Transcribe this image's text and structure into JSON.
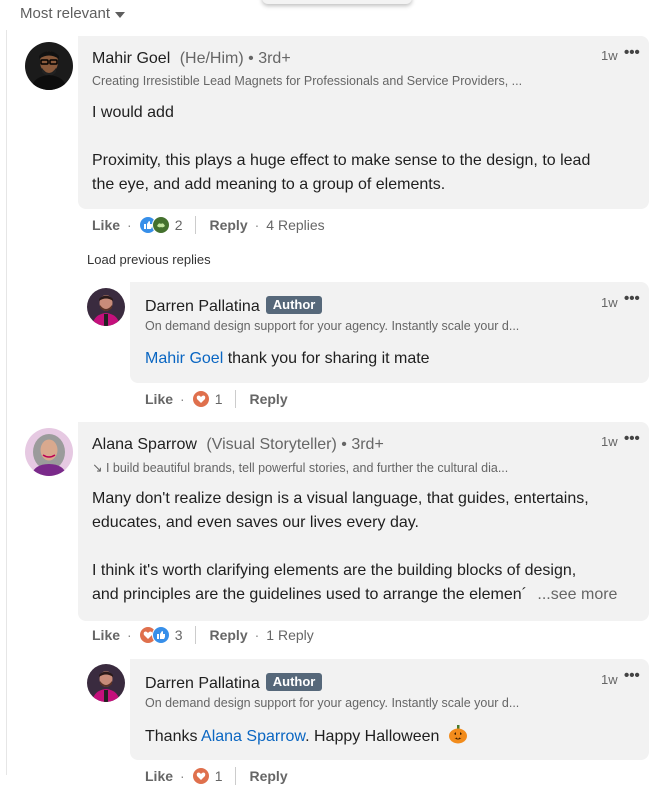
{
  "sort": {
    "label": "Most relevant"
  },
  "comments": [
    {
      "name": "Mahir Goel",
      "pronouns": "(He/Him)",
      "degree": "• 3rd+",
      "headline": "Creating Irresistible Lead Magnets for Professionals and Service Providers, ...",
      "time": "1w",
      "text1": "I would add",
      "text2a": "Proximity, this plays a huge effect to make sense to the design, to lead",
      "text2b": "the eye, and add meaning to a group of elements.",
      "like_label": "Like",
      "reaction_count": "2",
      "reply_label": "Reply",
      "replies_label": "4 Replies"
    },
    {
      "name": "Alana Sparrow",
      "pronouns": "(Visual Storyteller)",
      "degree": "• 3rd+",
      "headline": "↘ I build beautiful brands, tell powerful stories, and further the cultural dia...",
      "time": "1w",
      "line1": "Many don't realize design is a visual language, that guides, entertains,",
      "line2": "educates, and even saves our lives every day.",
      "line3": "I think it's worth clarifying elements are the building blocks of design,",
      "line4": "and principles are the guidelines used to arrange the elemen´",
      "see_more": "...see more",
      "like_label": "Like",
      "reaction_count": "3",
      "reply_label": "Reply",
      "replies_label": "1 Reply"
    }
  ],
  "load_previous": "Load previous replies",
  "replies": [
    {
      "name": "Darren Pallatina",
      "badge": "Author",
      "headline": "On demand design support for your agency. Instantly scale your d...",
      "time": "1w",
      "mention": "Mahir Goel",
      "text": " thank you for sharing it mate",
      "like_label": "Like",
      "reaction_count": "1",
      "reply_label": "Reply"
    },
    {
      "name": "Darren Pallatina",
      "badge": "Author",
      "headline": "On demand design support for your agency. Instantly scale your d...",
      "time": "1w",
      "prefix": "Thanks ",
      "mention": "Alana Sparrow",
      "text": ". Happy Halloween",
      "like_label": "Like",
      "reaction_count": "1",
      "reply_label": "Reply"
    }
  ],
  "icons": [
    "caret-down-icon",
    "more-options-icon",
    "like-reaction-icon",
    "support-reaction-icon",
    "love-reaction-icon",
    "pumpkin-emoji-icon"
  ],
  "colors": {
    "link": "#0a66c2",
    "author_badge": "#56687a",
    "bubble": "#f2f2f2"
  }
}
